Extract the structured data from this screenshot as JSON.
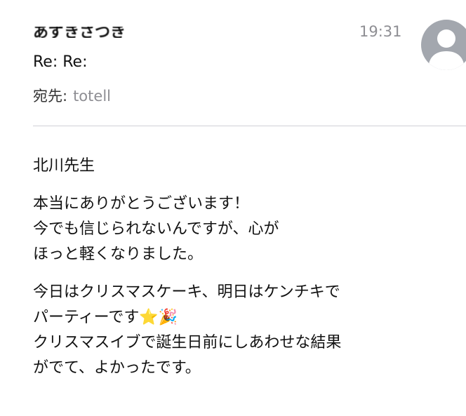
{
  "header": {
    "sender": "あずきさつき",
    "time": "19:31",
    "subject": "Re: Re:",
    "to_label": "宛先:",
    "to_value": "totell"
  },
  "body": {
    "greeting": "北川先生",
    "paragraph1": [
      "本当にありがとうございます！",
      "今でも信じられないんですが、心が",
      "ほっと軽くなりました。"
    ],
    "paragraph2": {
      "line1": "今日はクリスマスケーキ、明日はケンチキで",
      "line2_text": "パーティーです",
      "line2_emoji1": "⭐",
      "line2_emoji2": "🎉",
      "line3": "クリスマスイブで誕生日前にしあわせな結果",
      "line4": "がでて、よかったです。"
    }
  },
  "colors": {
    "avatar": "#a3a7ae",
    "meta_gray": "#8e8e93",
    "divider": "#d1d1d6"
  },
  "icons": {
    "avatar": "person-silhouette-icon",
    "star": "star-emoji",
    "party": "party-popper-emoji"
  }
}
